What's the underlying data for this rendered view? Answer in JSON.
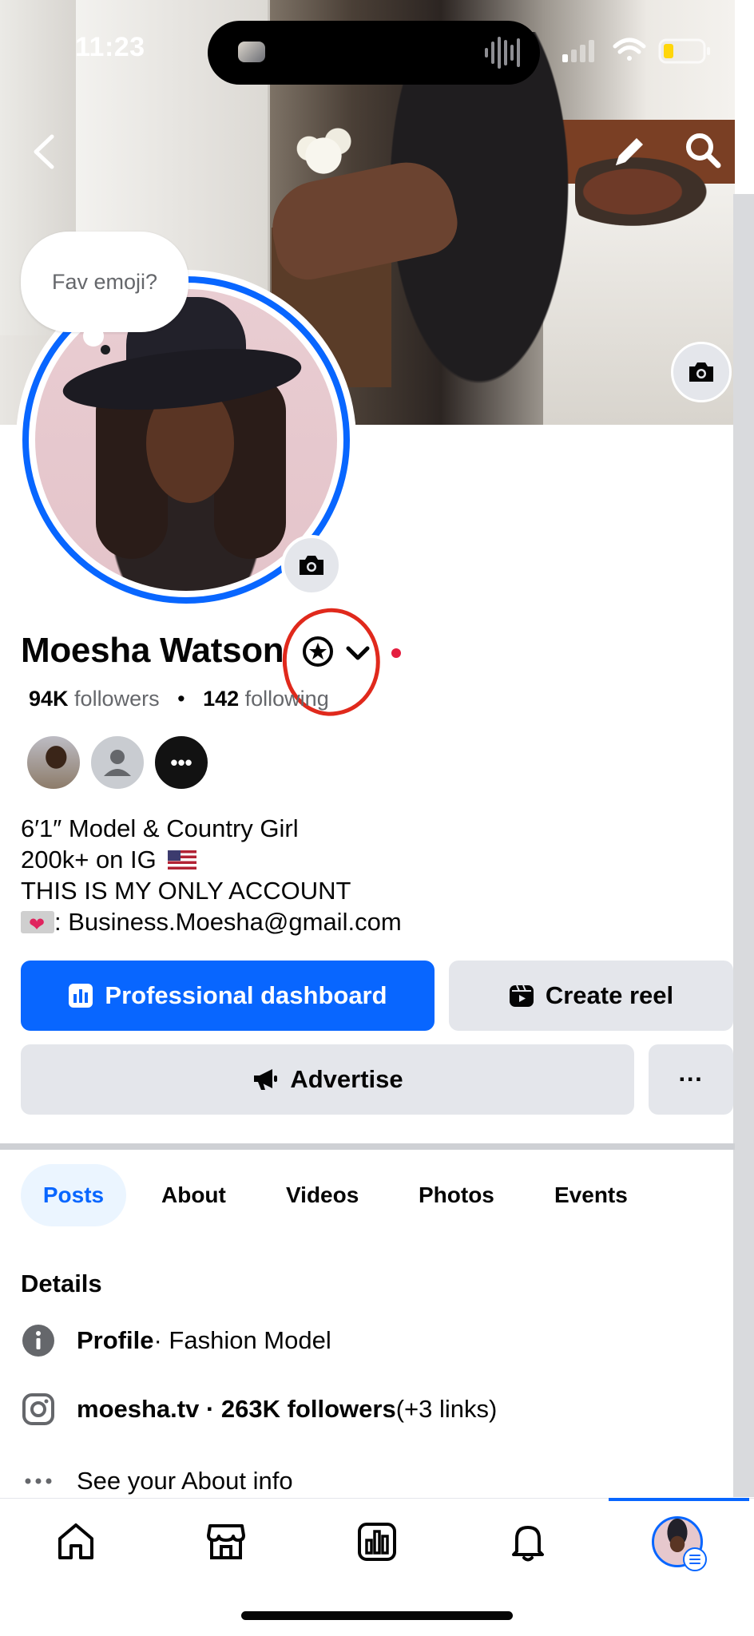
{
  "status_bar": {
    "time": "11:23"
  },
  "cover": {
    "back_icon": "chevron-left-icon",
    "edit_icon": "pencil-icon",
    "search_icon": "search-icon",
    "camera_icon": "camera-icon"
  },
  "avatar": {
    "fav_bubble_text": "Fav emoji?",
    "camera_icon": "camera-icon"
  },
  "profile": {
    "name": "Moesha Watson",
    "followers_count": "94K",
    "followers_label": "followers",
    "separator": "•",
    "following_count": "142",
    "following_label": "following",
    "friends_more": "•••"
  },
  "bio": {
    "line1": "6′1″ Model & Country Girl",
    "line2": "200k+ on IG",
    "line3": "THIS IS MY ONLY ACCOUNT",
    "line4": ": Business.Moesha@gmail.com"
  },
  "actions": {
    "pro_dashboard": "Professional dashboard",
    "create_reel": "Create reel",
    "advertise": "Advertise",
    "more": "···"
  },
  "tabs": [
    {
      "label": "Posts",
      "active": true
    },
    {
      "label": "About"
    },
    {
      "label": "Videos"
    },
    {
      "label": "Photos"
    },
    {
      "label": "Events"
    }
  ],
  "details": {
    "heading": "Details",
    "profile_bold": "Profile",
    "profile_rest": " · Fashion Model",
    "instagram_bold": "moesha.tv · 263K followers",
    "instagram_rest": " (+3 links)",
    "about_label": "See your About info"
  },
  "bottom_nav": {
    "items": [
      "home-icon",
      "marketplace-icon",
      "dashboard-icon",
      "notifications-icon",
      "profile-avatar"
    ],
    "active": "profile-avatar"
  },
  "colors": {
    "accent": "#0866ff",
    "annotation": "#e0291c",
    "online_dot": "#e41e3f",
    "secondary_button": "#e4e6eb",
    "muted_text": "#65676b"
  }
}
